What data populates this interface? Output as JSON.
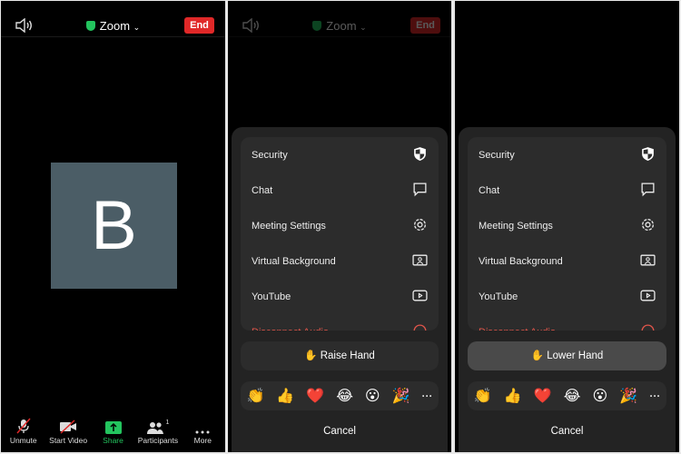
{
  "meeting": {
    "title": "Zoom",
    "end_label": "End",
    "avatar_letter": "B"
  },
  "toolbar": [
    {
      "label": "Unmute",
      "icon": "mic-muted-icon"
    },
    {
      "label": "Start Video",
      "icon": "video-off-icon"
    },
    {
      "label": "Share",
      "icon": "share-icon"
    },
    {
      "label": "Participants",
      "icon": "participants-icon",
      "badge": "1"
    },
    {
      "label": "More",
      "icon": "more-icon"
    }
  ],
  "menu": [
    {
      "label": "Security",
      "icon": "shield-icon"
    },
    {
      "label": "Chat",
      "icon": "chat-icon"
    },
    {
      "label": "Meeting Settings",
      "icon": "gear-icon"
    },
    {
      "label": "Virtual Background",
      "icon": "virtual-background-icon"
    },
    {
      "label": "YouTube",
      "icon": "youtube-icon"
    },
    {
      "label": "Disconnect Audio",
      "icon": "disconnect-audio-icon"
    }
  ],
  "panel2": {
    "hand_label": "✋ Raise Hand"
  },
  "panel3": {
    "hand_label": "✋ Lower Hand"
  },
  "reactions": [
    "👏",
    "👍",
    "❤️",
    "😂",
    "😮",
    "🎉",
    "···"
  ],
  "cancel_label": "Cancel",
  "colors": {
    "end": "#e02828",
    "share": "#23c45e",
    "avatar": "#4b5d66",
    "disconnect": "#e0554a"
  }
}
